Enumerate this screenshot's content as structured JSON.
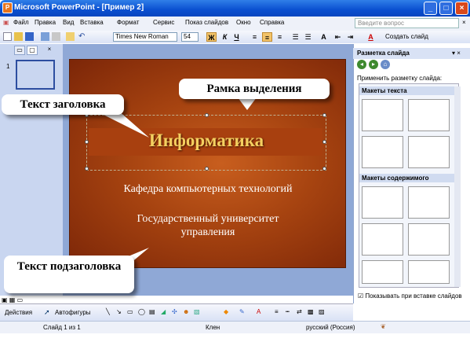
{
  "window": {
    "title": "Microsoft PowerPoint - [Пример 2]",
    "app_icon": "powerpoint-icon"
  },
  "menu": [
    "Файл",
    "Правка",
    "Вид",
    "Вставка",
    "Формат",
    "Сервис",
    "Показ слайдов",
    "Окно",
    "Справка"
  ],
  "help": {
    "placeholder": "Введите вопрос"
  },
  "formatting": {
    "font": "Times New Roman",
    "size": "54",
    "bold": "Ж",
    "italic": "К",
    "underline": "Ч",
    "new_slide": "Создать слайд"
  },
  "slides_panel": {
    "thumb_number": "1"
  },
  "slide": {
    "title": "Информатика",
    "subtitle_1": "Кафедра компьютерных технологий",
    "subtitle_2": "Государственный университет управления"
  },
  "callouts": {
    "title": "Текст заголовка",
    "selection": "Рамка выделения",
    "subtitle": "Текст подзаголовка"
  },
  "task_pane": {
    "heading": "Разметка слайда",
    "apply": "Применить разметку слайда:",
    "section_text": "Макеты текста",
    "section_content": "Макеты содержимого",
    "show_on_insert": "Показывать при вставке слайдов"
  },
  "drawing": {
    "actions": "Действия",
    "autoshapes": "Автофигуры"
  },
  "status": {
    "slide": "Слайд 1 из 1",
    "template": "Клен",
    "language": "русский (Россия)"
  },
  "colors": {
    "title_bar": "#0a4fd0",
    "slide_bg": "#a64310",
    "title_text": "#f4d060"
  }
}
